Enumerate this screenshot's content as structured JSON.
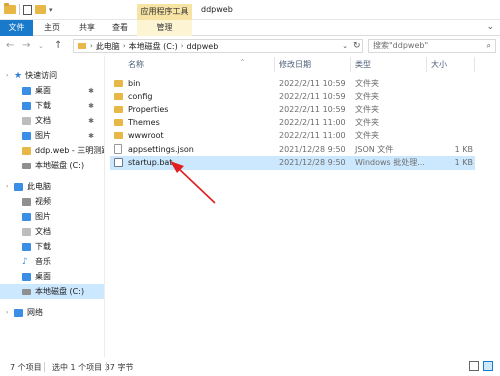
{
  "titlebar": {
    "contextual_tab": "应用程序工具",
    "window_title": "ddpweb"
  },
  "ribbon": {
    "tabs": [
      "文件",
      "主页",
      "共享",
      "查看",
      "管理"
    ]
  },
  "address": {
    "crumbs": [
      "此电脑",
      "本地磁盘 (C:)",
      "ddpweb"
    ],
    "search_placeholder": "搜索\"ddpweb\""
  },
  "nav": {
    "items": [
      {
        "label": "快速访问",
        "icon": "star-icon",
        "color": "#2f7fd4"
      },
      {
        "label": "桌面",
        "icon": "desktop-icon",
        "color": "#3a8ee6"
      },
      {
        "label": "下载",
        "icon": "download-icon",
        "color": "#3a8ee6"
      },
      {
        "label": "文档",
        "icon": "document-icon",
        "color": "#8f8f8f"
      },
      {
        "label": "图片",
        "icon": "picture-icon",
        "color": "#3a8ee6"
      },
      {
        "label": "ddp.web - 三明测距",
        "icon": "folder-icon",
        "color": "#e8b847"
      },
      {
        "label": "本地磁盘 (C:)",
        "icon": "drive-icon",
        "color": "#8f8f8f"
      },
      {
        "label": "此电脑",
        "icon": "computer-icon",
        "color": "#3a8ee6"
      },
      {
        "label": "视频",
        "icon": "video-icon",
        "color": "#8f8f8f"
      },
      {
        "label": "图片",
        "icon": "picture-icon",
        "color": "#3a8ee6"
      },
      {
        "label": "文档",
        "icon": "document-icon",
        "color": "#8f8f8f"
      },
      {
        "label": "下载",
        "icon": "download-icon",
        "color": "#3a8ee6"
      },
      {
        "label": "音乐",
        "icon": "music-icon",
        "color": "#3a8ee6"
      },
      {
        "label": "桌面",
        "icon": "desktop-icon",
        "color": "#3a8ee6"
      },
      {
        "label": "本地磁盘 (C:)",
        "icon": "drive-icon",
        "color": "#8f8f8f"
      },
      {
        "label": "网络",
        "icon": "network-icon",
        "color": "#3a8ee6"
      }
    ]
  },
  "table": {
    "headers": [
      "名称",
      "修改日期",
      "类型",
      "大小"
    ],
    "rows": [
      {
        "name": "bin",
        "date": "2022/2/11 10:59",
        "type": "文件夹",
        "size": "",
        "kind": "folder"
      },
      {
        "name": "config",
        "date": "2022/2/11 10:59",
        "type": "文件夹",
        "size": "",
        "kind": "folder"
      },
      {
        "name": "Properties",
        "date": "2022/2/11 10:59",
        "type": "文件夹",
        "size": "",
        "kind": "folder"
      },
      {
        "name": "Themes",
        "date": "2022/2/11 11:00",
        "type": "文件夹",
        "size": "",
        "kind": "folder"
      },
      {
        "name": "wwwroot",
        "date": "2022/2/11 11:00",
        "type": "文件夹",
        "size": "",
        "kind": "folder"
      },
      {
        "name": "appsettings.json",
        "date": "2021/12/28 9:50",
        "type": "JSON 文件",
        "size": "1 KB",
        "kind": "json"
      },
      {
        "name": "startup.bat",
        "date": "2021/12/28 9:50",
        "type": "Windows 批处理...",
        "size": "1 KB",
        "kind": "bat"
      }
    ]
  },
  "status": {
    "count": "7 个项目",
    "selection": "选中 1 个项目  37 字节"
  },
  "colors": {
    "accent": "#1979ca",
    "selection": "#cce8ff",
    "annotation_arrow": "#e02020"
  }
}
